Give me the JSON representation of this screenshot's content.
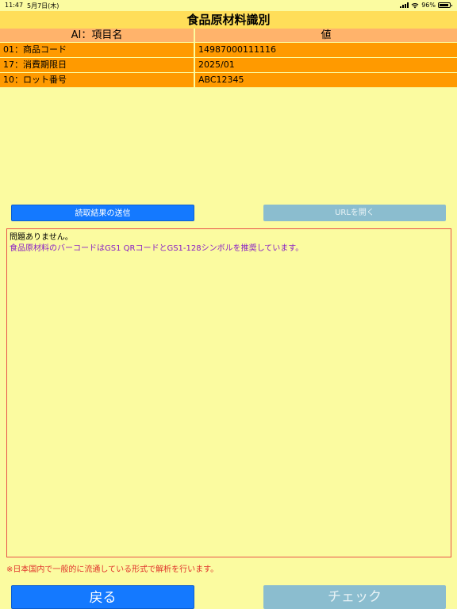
{
  "status_bar": {
    "time": "11:47",
    "date": "5月7日(木)",
    "battery": "96%"
  },
  "title": "食品原材料識別",
  "table": {
    "headers": [
      "AI：項目名",
      "値"
    ],
    "rows": [
      {
        "item": "01：商品コード",
        "value": "14987000111116"
      },
      {
        "item": "17：消費期限日",
        "value": "2025/01"
      },
      {
        "item": "10：ロット番号",
        "value": "ABC12345"
      }
    ]
  },
  "buttons": {
    "send": "読取結果の送信",
    "open_url": "URLを開く",
    "back": "戻る",
    "check": "チェック"
  },
  "message": {
    "line1": "問題ありません。",
    "line2": "食品原材料のバーコードはGS1 QRコードとGS1-128シンボルを推奨しています。"
  },
  "note": "※日本国内で一般的に流通している形式で解析を行います。",
  "colors": {
    "background": "#fbfba0",
    "title_bg": "#ffde59",
    "header_bg": "#ffb36b",
    "row_bg": "#ff9a00",
    "primary_button": "#1479ff",
    "disabled_button": "#8bbdcf",
    "message_purple": "#8a21c5",
    "note_red": "#e0322b"
  }
}
